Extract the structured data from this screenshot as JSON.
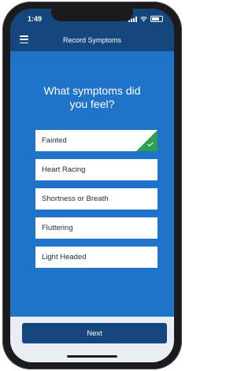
{
  "status_bar": {
    "time": "1:49"
  },
  "nav": {
    "title": "Record Symptoms"
  },
  "question": "What symptoms did you feel?",
  "options": [
    {
      "label": "Fainted",
      "selected": true
    },
    {
      "label": "Heart Racing",
      "selected": false
    },
    {
      "label": "Shortness or Breath",
      "selected": false
    },
    {
      "label": "Fluttering",
      "selected": false
    },
    {
      "label": "Light Headed",
      "selected": false
    }
  ],
  "next_button": {
    "label": "Next"
  },
  "colors": {
    "background": "#1f73c9",
    "header": "#16467e",
    "check": "#2fa04f",
    "button": "#16467e"
  }
}
